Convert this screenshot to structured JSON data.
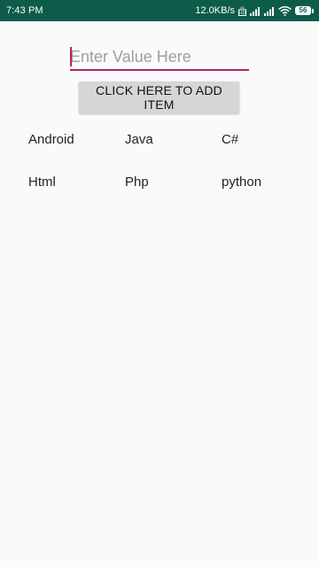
{
  "status_bar": {
    "time": "7:43 PM",
    "net_speed": "12.0KB/s",
    "battery_level": "56",
    "icons": [
      "hd-volte-icon",
      "cellular-signal-icon",
      "cellular-signal-icon",
      "wifi-icon",
      "battery-icon"
    ],
    "bg_color": "#0d5c4a"
  },
  "form": {
    "input_placeholder": "Enter Value Here",
    "input_value": "",
    "button_label": "CLICK HERE TO ADD ITEM",
    "accent_color": "#ad2468"
  },
  "items": [
    "Android",
    "Java",
    "C#",
    "Html",
    "Php",
    "python"
  ]
}
